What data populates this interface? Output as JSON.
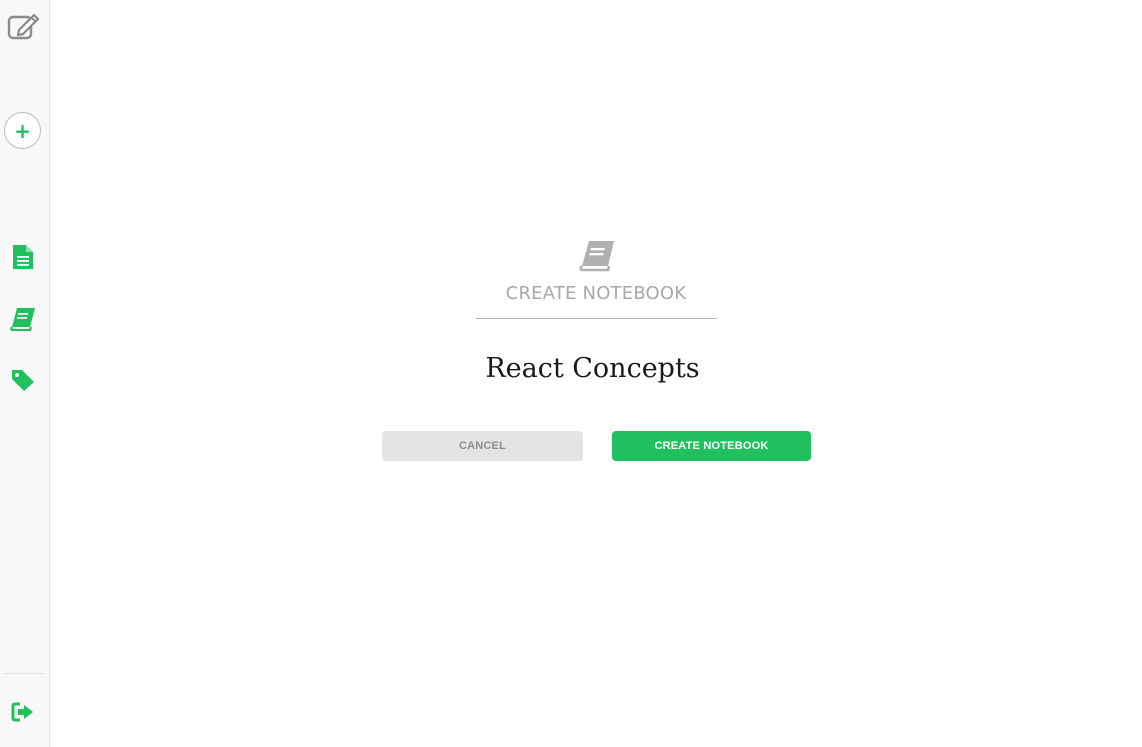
{
  "sidebar": {
    "icons": {
      "new_note": "pencil-square-icon",
      "add": "plus-icon",
      "notes": "note-document-icon",
      "notebooks": "notebook-icon",
      "tags": "tag-icon",
      "logout": "sign-out-icon"
    },
    "add_symbol": "+"
  },
  "form": {
    "heading": "CREATE NOTEBOOK",
    "notebook_name": "React Concepts",
    "cancel_label": "CANCEL",
    "create_label": "CREATE NOTEBOOK"
  },
  "colors": {
    "accent_green": "#1fc05d",
    "muted_gray": "#a8a8a8",
    "cancel_bg": "#e4e4e4",
    "sidebar_bg": "#f8f8f8"
  }
}
